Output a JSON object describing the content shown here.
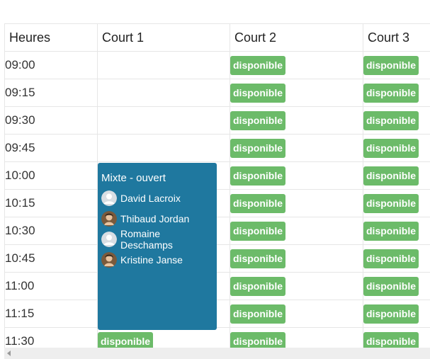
{
  "header": {
    "time_label": "Heures",
    "courts": [
      "Court 1",
      "Court 2",
      "Court 3"
    ]
  },
  "times": [
    "09:00",
    "09:15",
    "09:30",
    "09:45",
    "10:00",
    "10:15",
    "10:30",
    "10:45",
    "11:00",
    "11:15",
    "11:30"
  ],
  "available_label": "disponible",
  "availability": {
    "court1": [
      false,
      false,
      false,
      false,
      false,
      false,
      false,
      false,
      false,
      false,
      true
    ],
    "court2": [
      true,
      true,
      true,
      true,
      true,
      true,
      true,
      true,
      true,
      true,
      true
    ],
    "court3": [
      true,
      true,
      true,
      true,
      true,
      true,
      true,
      true,
      true,
      true,
      true
    ]
  },
  "booking": {
    "title": "Mixte - ouvert",
    "court": "Court 1",
    "start": "10:00",
    "end": "11:30",
    "players": [
      {
        "name": "David Lacroix",
        "avatar": "default-avatar-icon"
      },
      {
        "name": "Thibaud Jordan",
        "avatar": "photo-avatar"
      },
      {
        "name": "Romaine Deschamps",
        "avatar": "default-avatar-icon"
      },
      {
        "name": "Kristine Janse",
        "avatar": "photo-avatar"
      }
    ]
  },
  "colors": {
    "available": "#6cbb69",
    "booking": "#1f789f"
  }
}
